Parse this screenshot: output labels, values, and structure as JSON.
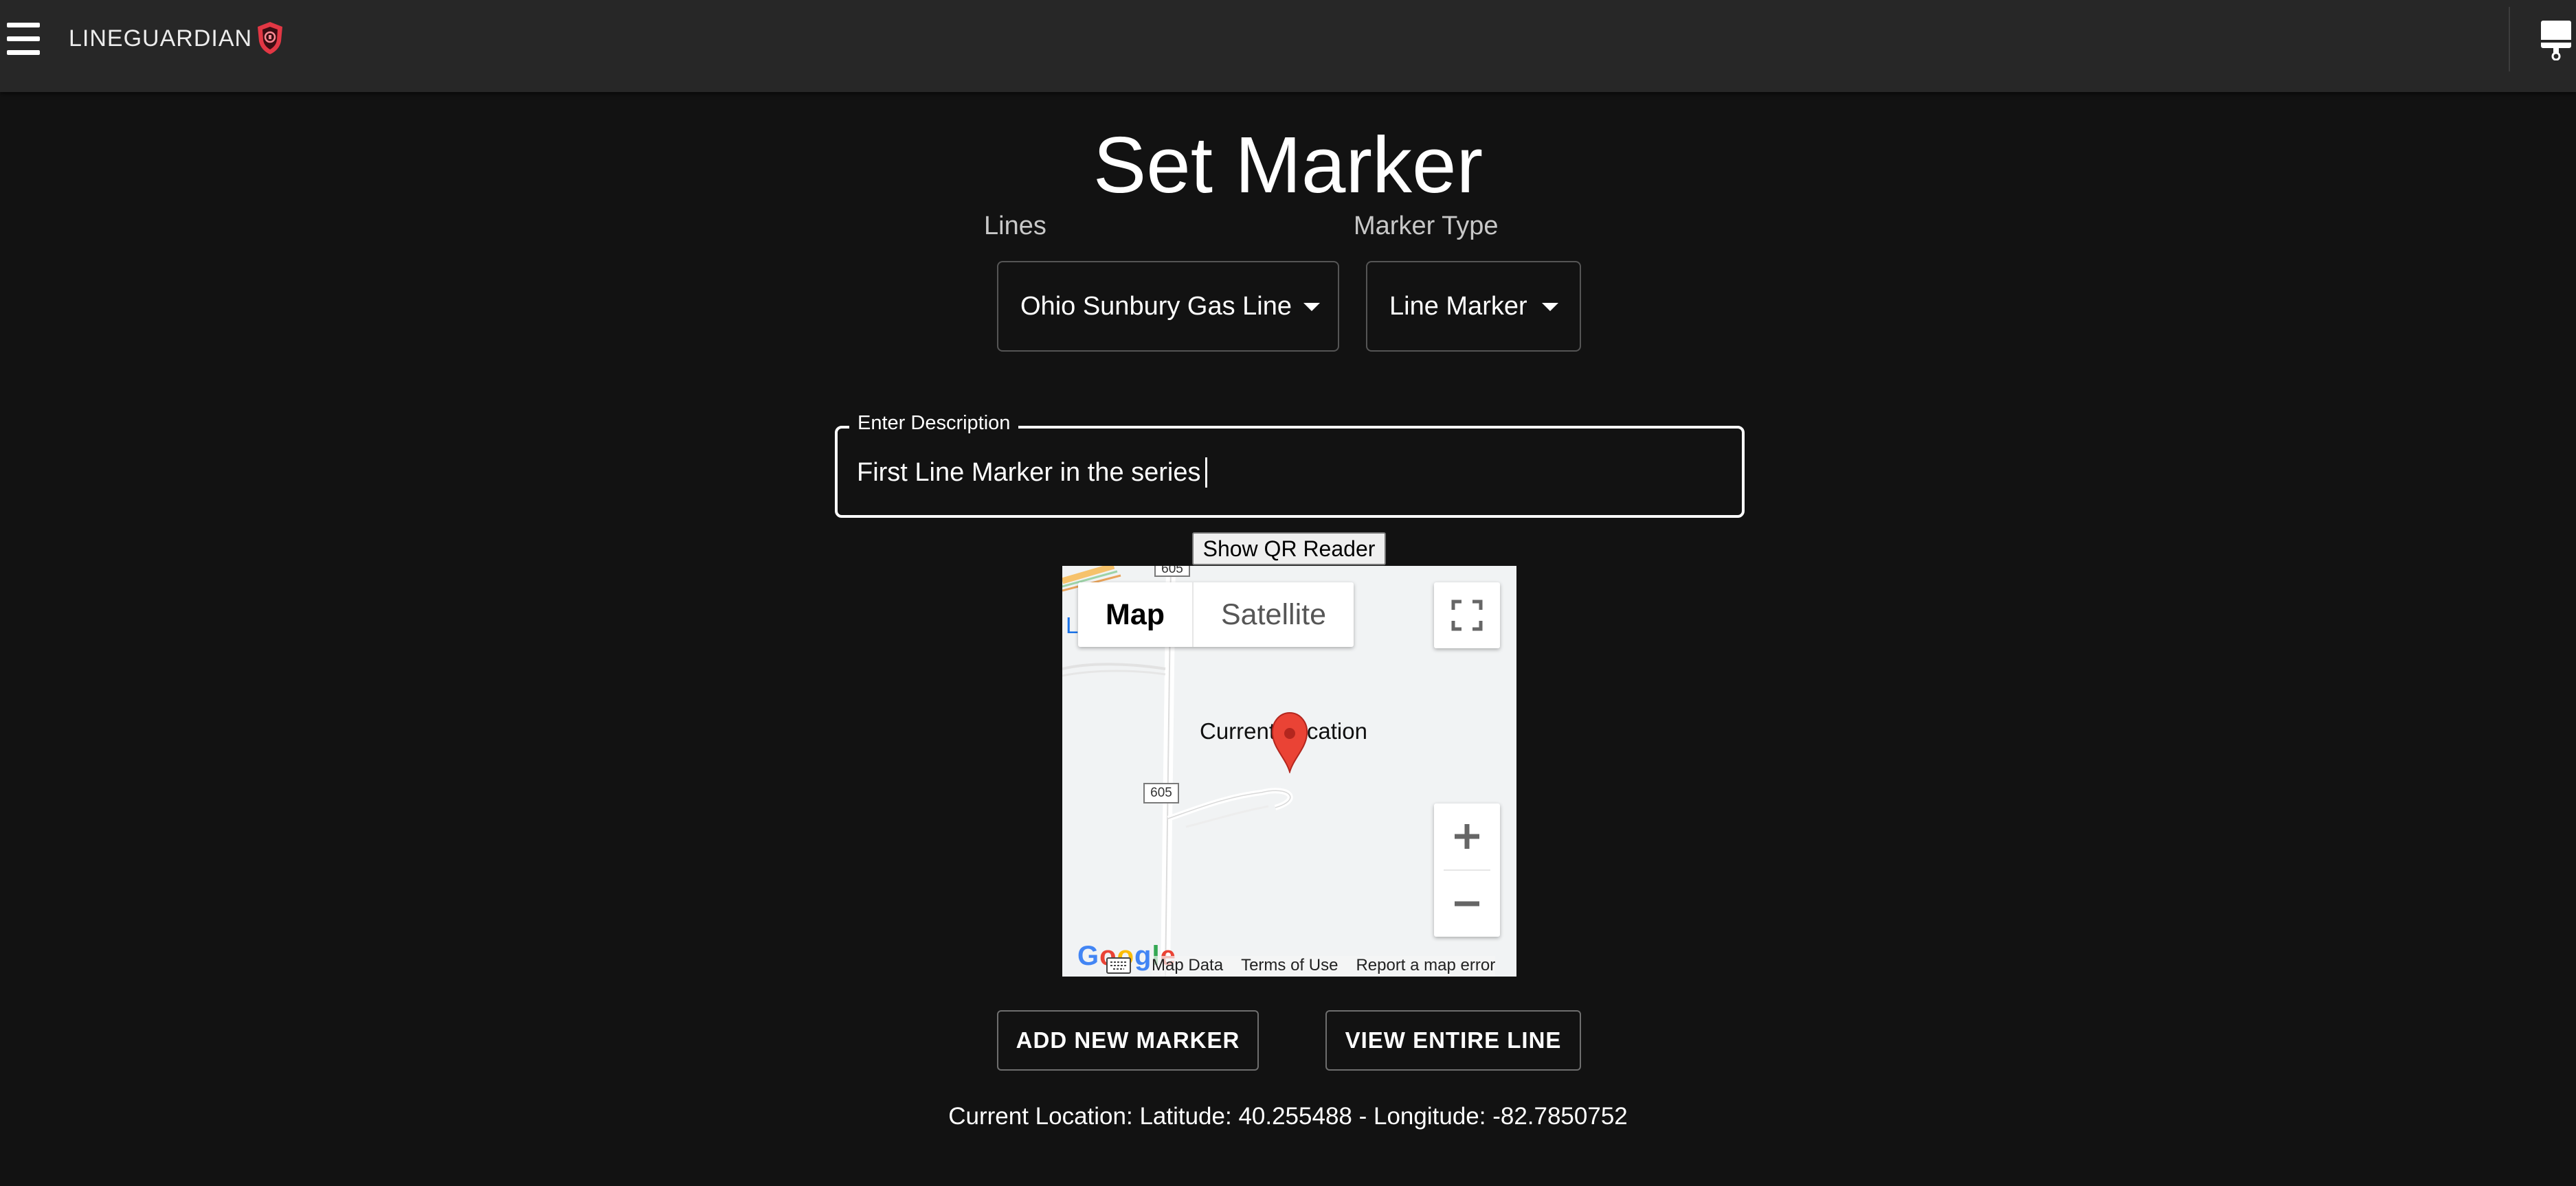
{
  "app": {
    "brand_name": "LINEGUARDIAN",
    "accent_color": "#e23744"
  },
  "page": {
    "title": "Set Marker"
  },
  "lines_select": {
    "label": "Lines",
    "value": "Ohio Sunbury Gas Line"
  },
  "marker_type_select": {
    "label": "Marker Type",
    "value": "Line Marker"
  },
  "description": {
    "label": "Enter Description",
    "value": "First Line Marker in the series"
  },
  "qr": {
    "button_label": "Show QR Reader"
  },
  "map": {
    "type_map_label": "Map",
    "type_satellite_label": "Satellite",
    "marker_label": "Current Location",
    "route_number": "605",
    "partial_place_label": "L",
    "provider_logo": "Google",
    "footer_map_data": "Map Data",
    "footer_terms": "Terms of Use",
    "footer_report": "Report a map error",
    "icons": [
      "fullscreen-icon",
      "zoom-in-icon",
      "zoom-out-icon",
      "map-pin-icon",
      "keyboard-icon"
    ]
  },
  "actions": {
    "add_marker_label": "ADD NEW MARKER",
    "view_line_label": "VIEW ENTIRE LINE"
  },
  "location": {
    "readout": "Current Location: Latitude: 40.255488 - Longitude: -82.7850752"
  }
}
